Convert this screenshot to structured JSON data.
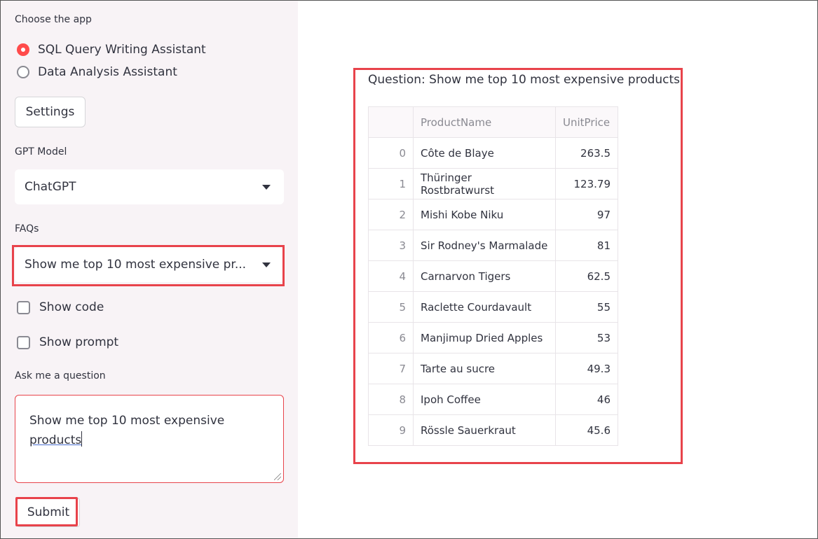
{
  "sidebar": {
    "app_label": "Choose the app",
    "apps": [
      {
        "label": "SQL Query Writing Assistant",
        "selected": true
      },
      {
        "label": "Data Analysis Assistant",
        "selected": false
      }
    ],
    "settings_label": "Settings",
    "model_label": "GPT Model",
    "model_value": "ChatGPT",
    "faq_label": "FAQs",
    "faq_value": "Show me top 10 most expensive pr...",
    "show_code_label": "Show code",
    "show_prompt_label": "Show prompt",
    "ask_label": "Ask me a question",
    "question_value_line1": "Show me top 10 most expensive",
    "question_value_line2": "products",
    "submit_label": "Submit"
  },
  "main": {
    "question_text": "Question: Show me top 10 most expensive products",
    "table": {
      "columns": [
        "",
        "ProductName",
        "UnitPrice"
      ],
      "rows": [
        [
          "0",
          "Côte de Blaye",
          "263.5"
        ],
        [
          "1",
          "Thüringer Rostbratwurst",
          "123.79"
        ],
        [
          "2",
          "Mishi Kobe Niku",
          "97"
        ],
        [
          "3",
          "Sir Rodney's Marmalade",
          "81"
        ],
        [
          "4",
          "Carnarvon Tigers",
          "62.5"
        ],
        [
          "5",
          "Raclette Courdavault",
          "55"
        ],
        [
          "6",
          "Manjimup Dried Apples",
          "53"
        ],
        [
          "7",
          "Tarte au sucre",
          "49.3"
        ],
        [
          "8",
          "Ipoh Coffee",
          "46"
        ],
        [
          "9",
          "Rössle Sauerkraut",
          "45.6"
        ]
      ]
    }
  },
  "colors": {
    "accent": "#ff4b4b",
    "highlight_border": "#e8434b",
    "sidebar_bg": "#f8f3f6"
  }
}
